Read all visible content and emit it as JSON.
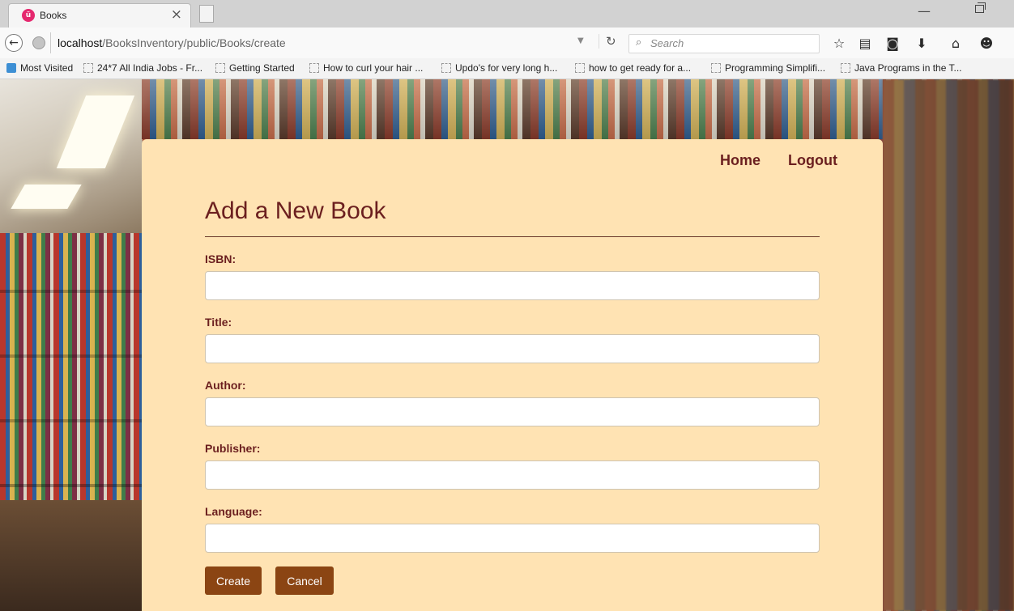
{
  "browser": {
    "tab_title": "Books",
    "tab_favicon": "ü",
    "url_host": "localhost",
    "url_path": "/BooksInventory/public/Books/create",
    "search_placeholder": "Search",
    "icons": [
      "back-arrow-icon",
      "globe-icon",
      "reload-icon",
      "search-icon",
      "star-icon",
      "reading-list-icon",
      "pocket-icon",
      "download-icon",
      "home-icon",
      "smiley-icon"
    ],
    "bookmarks": [
      "Most Visited",
      "24*7 All India Jobs - Fr...",
      "Getting Started",
      "How to curl your hair ...",
      "Updo's for very long h...",
      "how to get ready for a...",
      "Programming Simplifi...",
      "Java Programs in the T..."
    ]
  },
  "nav": {
    "home": "Home",
    "logout": "Logout"
  },
  "form": {
    "title": "Add a New Book",
    "fields": [
      {
        "label": "ISBN:",
        "value": ""
      },
      {
        "label": "Title:",
        "value": ""
      },
      {
        "label": "Author:",
        "value": ""
      },
      {
        "label": "Publisher:",
        "value": ""
      },
      {
        "label": "Language:",
        "value": ""
      }
    ],
    "create_label": "Create",
    "cancel_label": "Cancel"
  },
  "colors": {
    "card_background": "#ffe3b3",
    "heading_text": "#6b1f1f",
    "button_background": "#8b4513"
  }
}
